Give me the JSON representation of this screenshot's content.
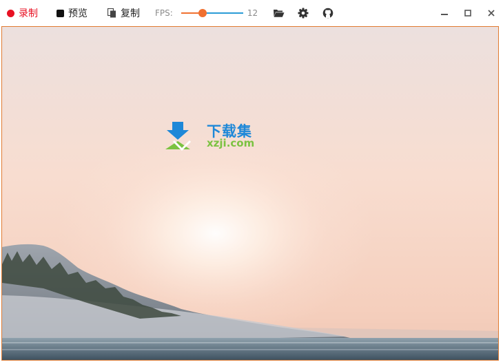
{
  "toolbar": {
    "record_label": "录制",
    "preview_label": "预览",
    "copy_label": "复制",
    "fps_label": "FPS:",
    "fps_value": "12",
    "fps_fraction": 0.35,
    "icons": [
      "folder-open-icon",
      "gear-icon",
      "github-icon"
    ]
  },
  "window_controls": [
    "minimize-icon",
    "maximize-icon",
    "close-icon"
  ],
  "watermark": {
    "title": "下载集",
    "url": "xzji.com"
  },
  "colors": {
    "record_red": "#e81123",
    "frame_border": "#e07a30",
    "slider_thumb": "#f07030",
    "slider_track": "#2a9bd6",
    "logo_blue": "#1e88d8",
    "logo_green": "#7cc242"
  }
}
